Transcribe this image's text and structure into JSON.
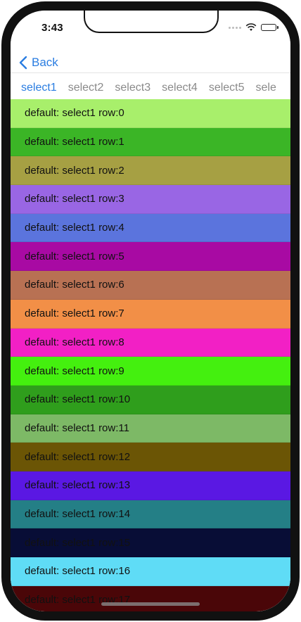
{
  "status": {
    "time": "3:43"
  },
  "nav": {
    "back_label": "Back"
  },
  "tabs": [
    "select1",
    "select2",
    "select3",
    "select4",
    "select5",
    "sele"
  ],
  "rows": [
    {
      "label": "default: select1 row:0",
      "color": "#a8ef6b"
    },
    {
      "label": "default: select1 row:1",
      "color": "#3bb526"
    },
    {
      "label": "default: select1 row:2",
      "color": "#a6a043"
    },
    {
      "label": "default: select1 row:3",
      "color": "#9966e4"
    },
    {
      "label": "default: select1 row:4",
      "color": "#5b74dd"
    },
    {
      "label": "default: select1 row:5",
      "color": "#a80aa3"
    },
    {
      "label": "default: select1 row:6",
      "color": "#b87153"
    },
    {
      "label": "default: select1 row:7",
      "color": "#f28f47"
    },
    {
      "label": "default: select1 row:8",
      "color": "#f220c5"
    },
    {
      "label": "default: select1 row:9",
      "color": "#44f00f"
    },
    {
      "label": "default: select1 row:10",
      "color": "#2f9e1c"
    },
    {
      "label": "default: select1 row:11",
      "color": "#7db966"
    },
    {
      "label": "default: select1 row:12",
      "color": "#6b5505"
    },
    {
      "label": "default: select1 row:13",
      "color": "#5a18e3"
    },
    {
      "label": "default: select1 row:14",
      "color": "#247f86"
    },
    {
      "label": "default: select1 row:15",
      "color": "#080d36"
    },
    {
      "label": "default: select1 row:16",
      "color": "#5fdcf6"
    },
    {
      "label": "default: select1 row:17",
      "color": "#4a0608"
    }
  ]
}
